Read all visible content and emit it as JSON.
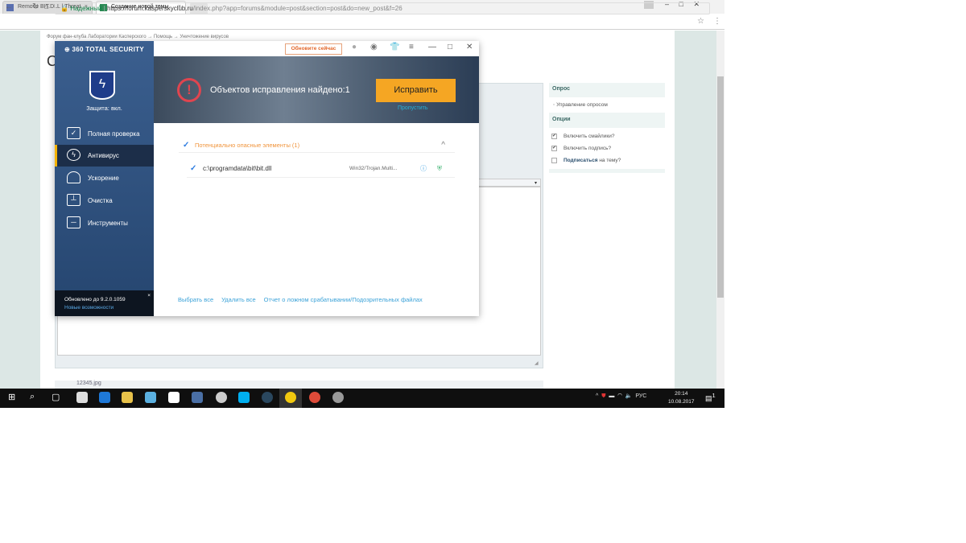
{
  "browser": {
    "tabs": [
      {
        "label": "Remove BIT.DLL | Threat"
      },
      {
        "label": "Создание новой темы"
      }
    ],
    "secure_label": "Надежный",
    "url_host": "https://forum.kasperskyclub.ru",
    "url_path": "/index.php?app=forums&module=post&section=post&do=new_post&f=26"
  },
  "forum": {
    "breadcrumb": "Форум фан-клуба Лаборатории Касперского  →  Помощь  →  Уничтожение вирусов",
    "title_initial": "С",
    "attachment": "12345.jpg",
    "sidebar": {
      "poll_header": "Опрос",
      "poll_item": "Управление опросом",
      "options_header": "Опции",
      "options": [
        {
          "label": "Включить смайлики?",
          "checked": true
        },
        {
          "label": "Включить подпись?",
          "checked": true
        }
      ],
      "subscribe_bold": "Подписаться",
      "subscribe_rest": " на тему?"
    }
  },
  "app": {
    "logo": "360 TOTAL SECURITY",
    "protection": "Защита: вкл.",
    "update_now": "Обновите сейчас",
    "menu": [
      {
        "label": "Полная проверка",
        "icon": "monitor-check-icon"
      },
      {
        "label": "Антивирус",
        "icon": "antivirus-icon",
        "active": true
      },
      {
        "label": "Ускорение",
        "icon": "rocket-icon"
      },
      {
        "label": "Очистка",
        "icon": "broom-icon"
      },
      {
        "label": "Инструменты",
        "icon": "toolbox-icon"
      }
    ],
    "updated": "Обновлено до 9.2.0.1059",
    "new_features": "Новые возможности",
    "found": "Объектов исправления найдено:1",
    "fix": "Исправить",
    "skip": "Пропустить",
    "group": "Потенциально опасные элементы (1)",
    "item_path": "c:\\programdata\\bit\\bit.dll",
    "item_threat": "Win32/Trojan.Multi...",
    "links": [
      "Выбрать все",
      "Удалить все",
      "Отчет о ложном срабатывании/Подозрительных файлах"
    ]
  },
  "taskbar": {
    "lang": "РУС",
    "time": "20:14",
    "date": "10.08.2017",
    "notifications": "1"
  }
}
